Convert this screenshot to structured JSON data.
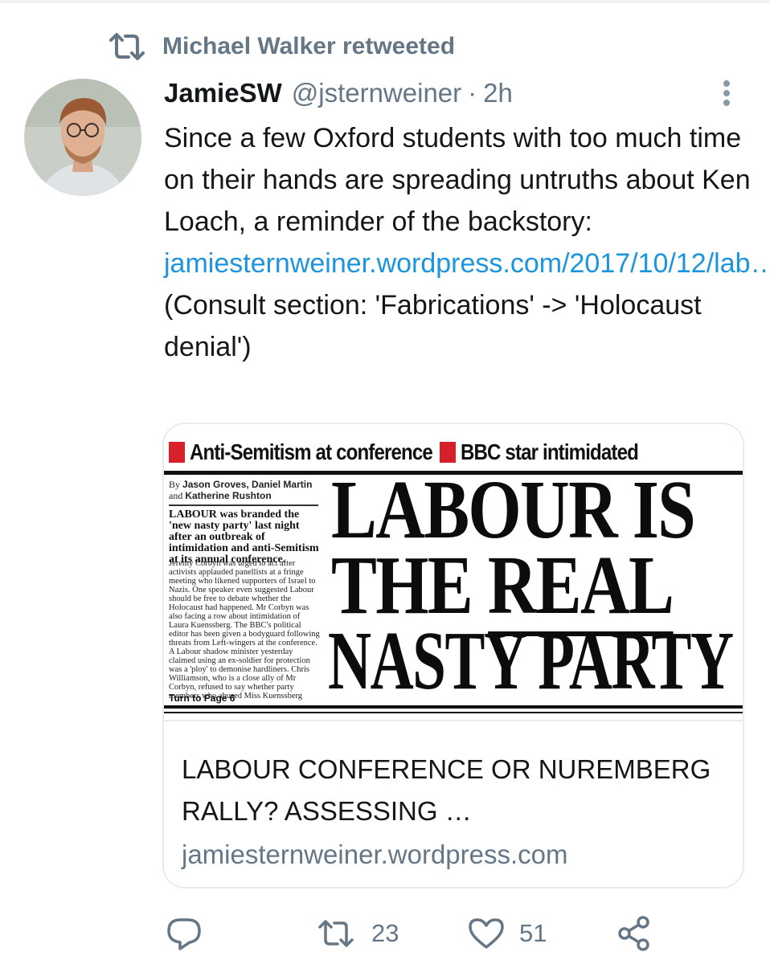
{
  "retweet": {
    "label": "Michael Walker retweeted",
    "icon": "retweet-icon"
  },
  "tweet": {
    "display_name": "JamieSW",
    "handle": "@jsternweiner",
    "separator": "·",
    "time": "2h",
    "text_before_link": "Since a few Oxford students with too much time on their hands are spreading untruths about Ken Loach, a reminder of the backstory: ",
    "link_text": "jamiesternweiner.wordpress.com/2017/10/12/lab…",
    "text_after_link": " (Consult section: 'Fabrications' -> 'Holocaust denial')"
  },
  "card": {
    "title": "LABOUR CONFERENCE OR NUREMBERG RALLY? ASSESSING …",
    "domain": "jamiesternweiner.wordpress.com",
    "image": {
      "kicker_left": "Anti-Semitism at conference",
      "kicker_right": "BBC star intimidated",
      "byline_prefix": "By",
      "byline_names_1": "Jason Groves, Daniel Martin",
      "byline_and": "and",
      "byline_names_2": "Katherine Rushton",
      "lead": "LABOUR was branded the 'new nasty party' last night after an outbreak of intimidation and anti-Semitism at its annual conference.",
      "body": "Jeremy Corbyn was urged to act after activists applauded panellists at a fringe meeting who likened supporters of Israel to Nazis. One speaker even suggested Labour should be free to debate whether the Holocaust had happened. Mr Corbyn was also facing a row about intimidation of Laura Kuenssberg. The BBC's political editor has been given a bodyguard following threats from Left-wingers at the conference. A Labour shadow minister yesterday claimed using an ex-soldier for protection was a 'ploy' to demonise hardliners. Chris Williamson, who is a close ally of Mr Corbyn, refused to say whether party members who abused Miss Kuenssberg",
      "turn": "Turn to Page 6",
      "headline_1": "LABOUR IS",
      "headline_2a": "THE ",
      "headline_2b": "REAL",
      "headline_3": "NASTY PARTY"
    }
  },
  "actions": {
    "reply_icon": "reply-icon",
    "retweet_icon": "retweet-icon",
    "retweet_count": "23",
    "like_icon": "heart-icon",
    "like_count": "51",
    "share_icon": "share-icon"
  },
  "colors": {
    "link": "#1b95e0",
    "secondary": "#657786",
    "text": "#14171a",
    "accent_red": "#d6202a"
  }
}
